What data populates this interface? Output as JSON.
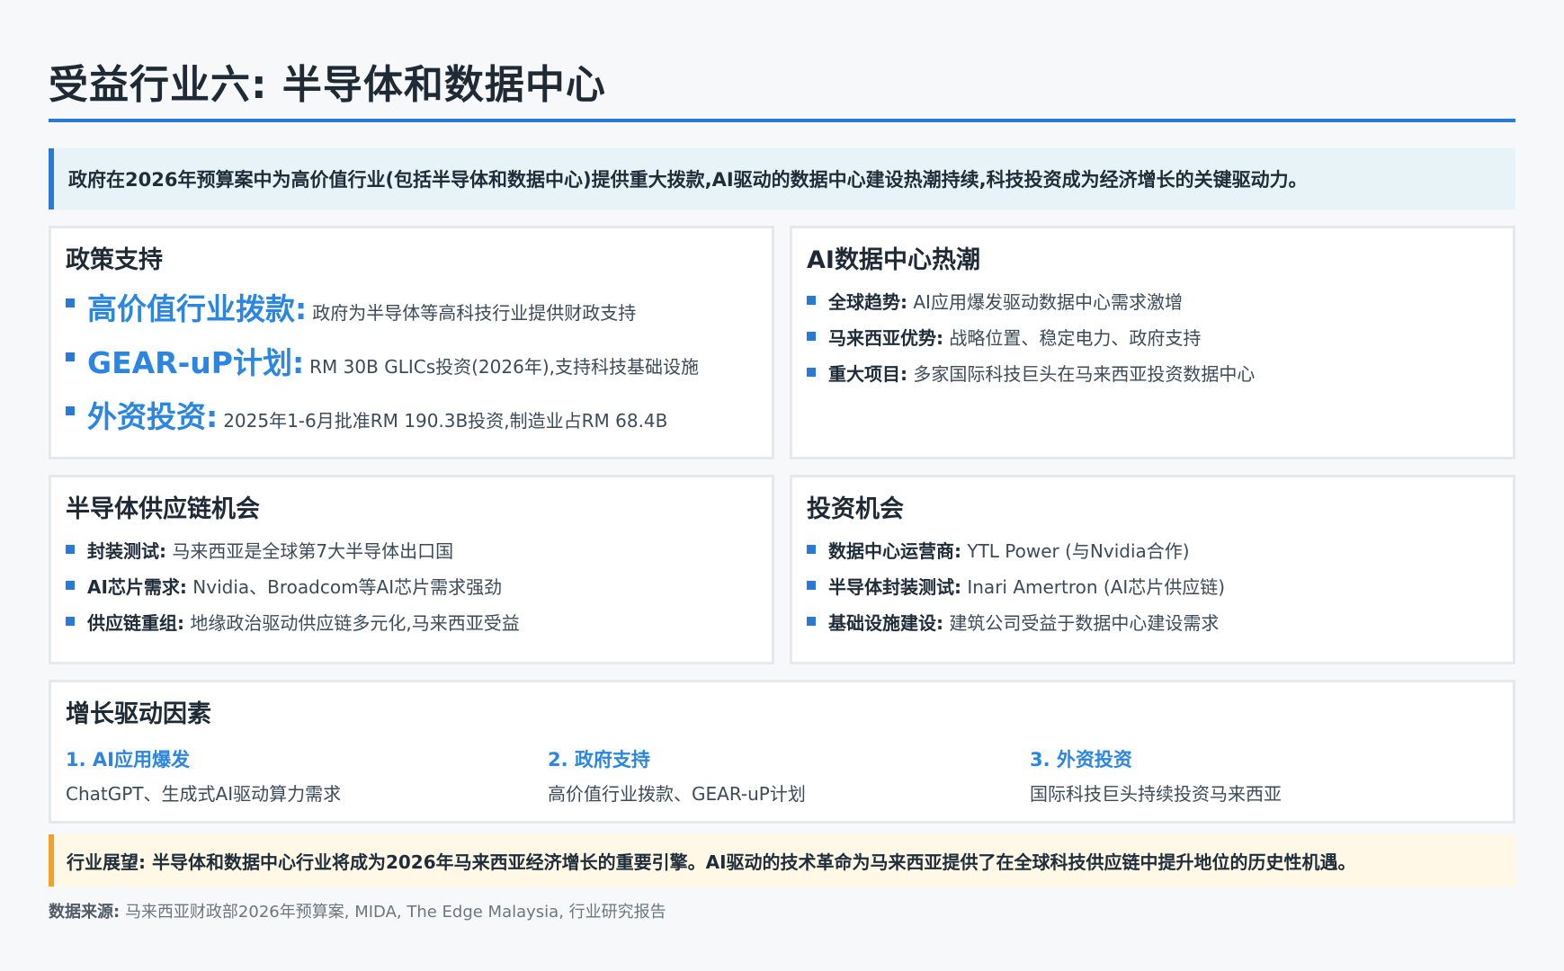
{
  "title": "受益行业六: 半导体和数据中心",
  "summary": "政府在2026年预算案中为高价值行业(包括半导体和数据中心)提供重大拨款,AI驱动的数据中心建设热潮持续,科技投资成为经济增长的关键驱动力。",
  "policy": {
    "heading": "政策支持",
    "items": [
      {
        "key": "高价值行业拨款:",
        "text": "政府为半导体等高科技行业提供财政支持"
      },
      {
        "key": "GEAR-uP计划:",
        "text": "RM 30B GLICs投资(2026年),支持科技基础设施"
      },
      {
        "key": "外资投资:",
        "text": "2025年1-6月批准RM 190.3B投资,制造业占RM 68.4B"
      }
    ]
  },
  "ai_dc": {
    "heading": "AI数据中心热潮",
    "items": [
      {
        "key": "全球趋势:",
        "text": "AI应用爆发驱动数据中心需求激增"
      },
      {
        "key": "马来西亚优势:",
        "text": "战略位置、稳定电力、政府支持"
      },
      {
        "key": "重大项目:",
        "text": "多家国际科技巨头在马来西亚投资数据中心"
      }
    ]
  },
  "semi": {
    "heading": "半导体供应链机会",
    "items": [
      {
        "key": "封装测试:",
        "text": "马来西亚是全球第7大半导体出口国"
      },
      {
        "key": "AI芯片需求:",
        "text": "Nvidia、Broadcom等AI芯片需求强劲"
      },
      {
        "key": "供应链重组:",
        "text": "地缘政治驱动供应链多元化,马来西亚受益"
      }
    ]
  },
  "invest": {
    "heading": "投资机会",
    "items": [
      {
        "key": "数据中心运营商:",
        "text": "YTL Power (与Nvidia合作)"
      },
      {
        "key": "半导体封装测试:",
        "text": "Inari Amertron (AI芯片供应链)"
      },
      {
        "key": "基础设施建设:",
        "text": "建筑公司受益于数据中心建设需求"
      }
    ]
  },
  "growth": {
    "heading": "增长驱动因素",
    "items": [
      {
        "title": "1. AI应用爆发",
        "desc": "ChatGPT、生成式AI驱动算力需求"
      },
      {
        "title": "2. 政府支持",
        "desc": "高价值行业拨款、GEAR-uP计划"
      },
      {
        "title": "3. 外资投资",
        "desc": "国际科技巨头持续投资马来西亚"
      }
    ]
  },
  "outlook": "行业展望: 半导体和数据中心行业将成为2026年马来西亚经济增长的重要引擎。AI驱动的技术革命为马来西亚提供了在全球科技供应链中提升地位的历史性机遇。",
  "source": {
    "label": "数据来源:",
    "text": "马来西亚财政部2026年预算案, MIDA, The Edge Malaysia, 行业研究报告"
  }
}
